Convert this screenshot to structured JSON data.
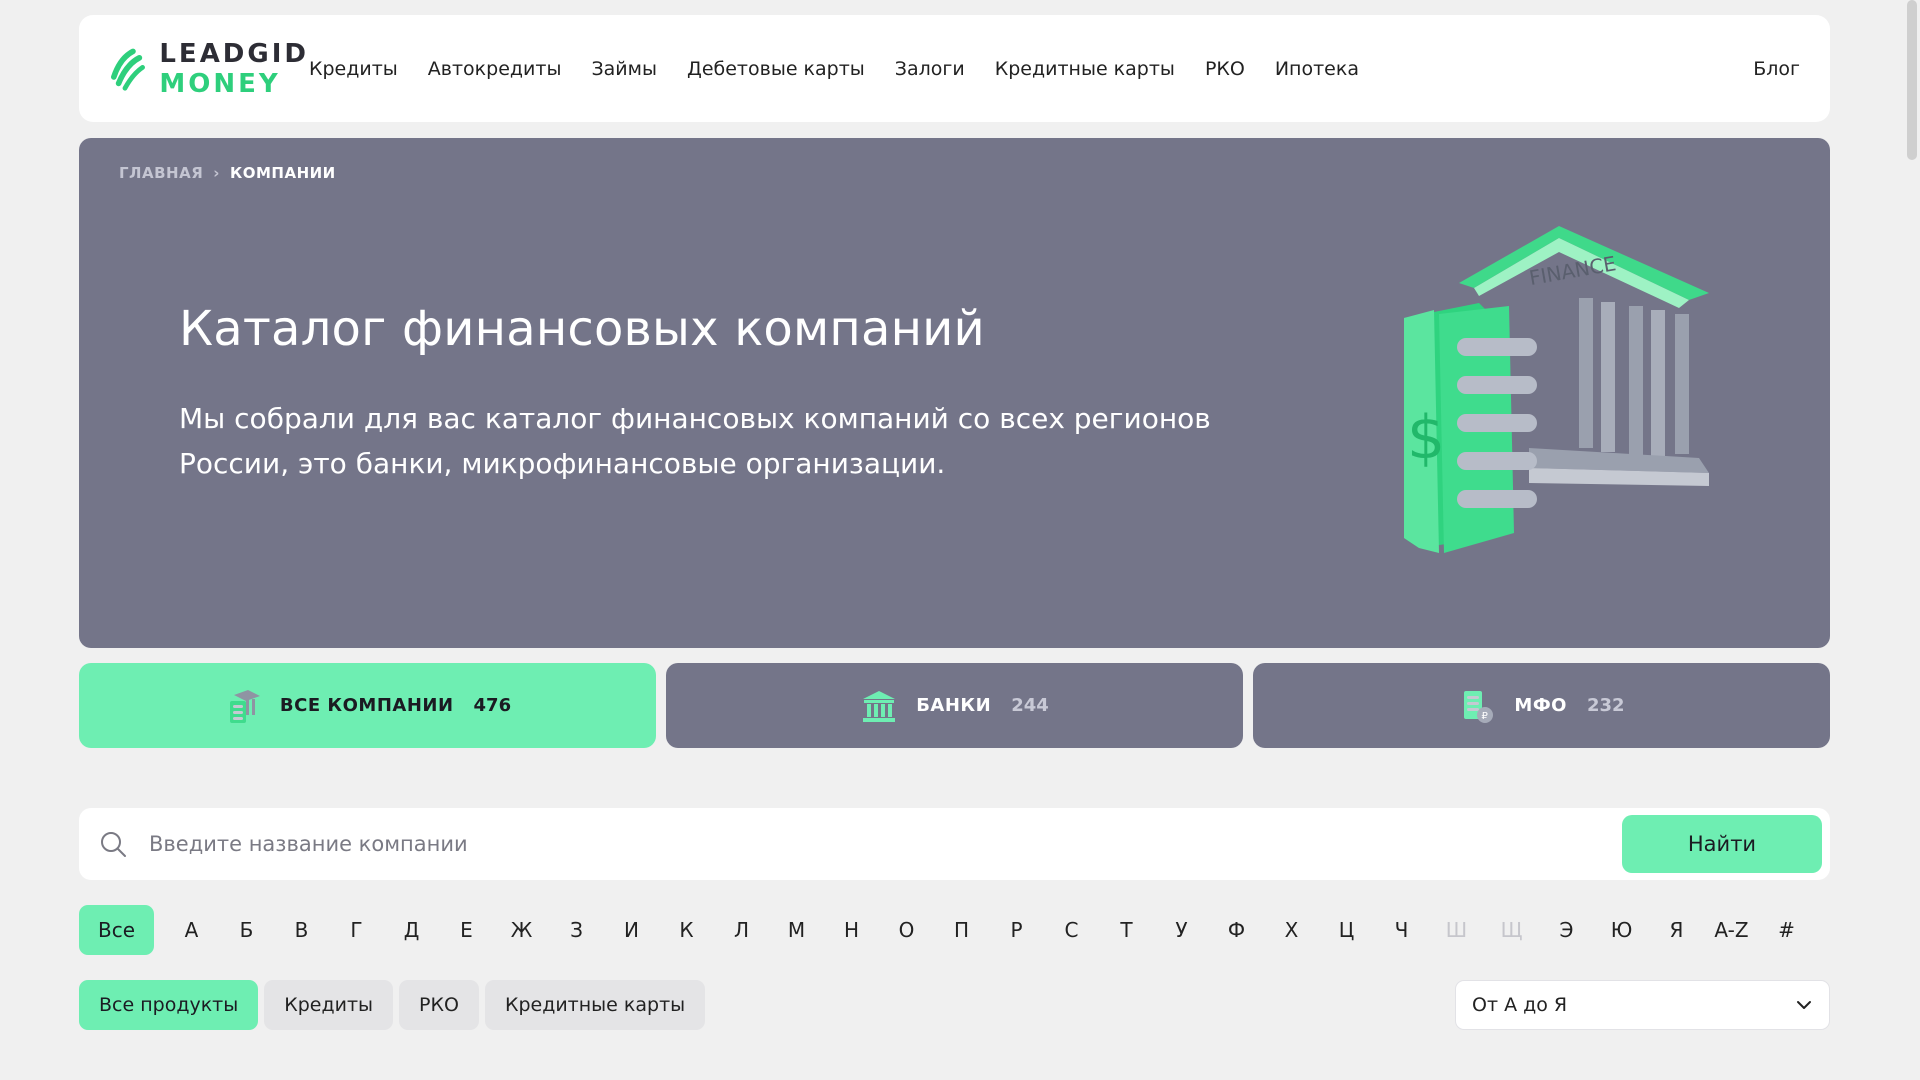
{
  "logo": {
    "top": "LEADGID",
    "bottom": "MONEY"
  },
  "nav": {
    "items": [
      "Кредиты",
      "Автокредиты",
      "Займы",
      "Дебетовые карты",
      "Залоги",
      "Кредитные карты",
      "РКО",
      "Ипотека"
    ],
    "blog": "Блог"
  },
  "breadcrumb": {
    "home": "ГЛАВНАЯ",
    "separator": "›",
    "current": "КОМПАНИИ"
  },
  "hero": {
    "title": "Каталог финансовых компаний",
    "description": "Мы собрали для вас каталог финансовых компаний со всех регионов России, это банки, микрофинансовые организации.",
    "illustration_label": "FINANCE"
  },
  "tabs": [
    {
      "label": "ВСЕ КОМПАНИИ",
      "count": "476",
      "icon": "companies-icon",
      "active": true
    },
    {
      "label": "БАНКИ",
      "count": "244",
      "icon": "bank-icon",
      "active": false
    },
    {
      "label": "МФО",
      "count": "232",
      "icon": "mfo-icon",
      "active": false
    }
  ],
  "search": {
    "placeholder": "Введите название компании",
    "value": "",
    "button": "Найти"
  },
  "alphabet": {
    "all": "Все",
    "letters": [
      "А",
      "Б",
      "В",
      "Г",
      "Д",
      "Е",
      "Ж",
      "З",
      "И",
      "К",
      "Л",
      "М",
      "Н",
      "О",
      "П",
      "Р",
      "С",
      "Т",
      "У",
      "Ф",
      "Х",
      "Ц",
      "Ч",
      "Ш",
      "Щ",
      "Э",
      "Ю",
      "Я",
      "A-Z",
      "#"
    ],
    "disabled": [
      "Ш",
      "Щ"
    ]
  },
  "filters": {
    "chips": [
      "Все продукты",
      "Кредиты",
      "РКО",
      "Кредитные карты"
    ],
    "active": "Все продукты",
    "sort": "От А до Я"
  },
  "colors": {
    "accent": "#6eeeb2",
    "hero_bg": "#747589",
    "page_bg": "#f0f0f0"
  }
}
